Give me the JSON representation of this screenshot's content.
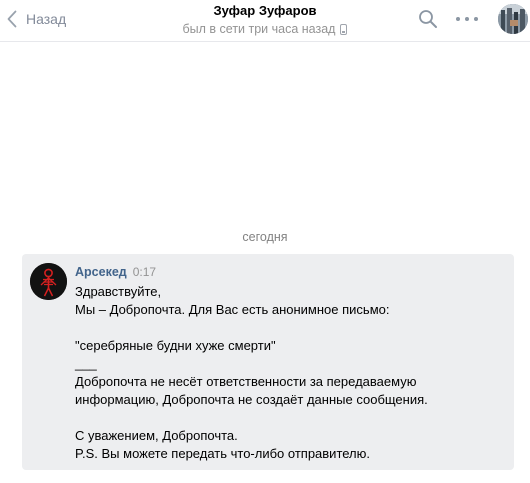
{
  "header": {
    "back_label": "Назад",
    "title": "Зуфар Зуфаров",
    "status": "был в сети три часа назад"
  },
  "date_separator": "сегодня",
  "message": {
    "author": "Арсекед",
    "time": "0:17",
    "lines": [
      "Здравствуйте,",
      "Мы – Добропочта. Для Вас есть анонимное письмо:",
      "",
      "\"серебряные будни хуже смерти\"",
      "___",
      "Добропочта не несёт ответственности за передаваемую",
      "информацию, Добропочта не создаёт данные сообщения.",
      "",
      "С уважением, Добропочта.",
      "P.S. Вы можете передать что-либо отправителю."
    ]
  },
  "icons": {
    "back": "chevron-left-icon",
    "status_device": "mobile-phone-icon",
    "search": "search-icon",
    "more": "more-horizontal-icon"
  },
  "colors": {
    "author_link": "#42648b",
    "message_bg": "#edeef0",
    "muted_text": "#939393",
    "header_icons": "#8b96a3"
  }
}
